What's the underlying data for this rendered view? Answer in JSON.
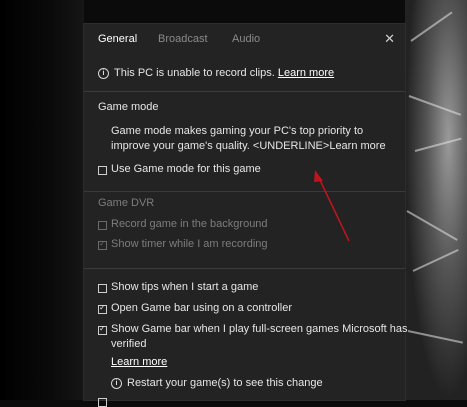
{
  "tabs": [
    {
      "label": "General",
      "active": true
    },
    {
      "label": "Broadcast",
      "active": false
    },
    {
      "label": "Audio",
      "active": false
    }
  ],
  "close_icon": "close-icon",
  "notice": {
    "text": "This PC is unable to record clips.",
    "link": "Learn more"
  },
  "game_mode": {
    "title": "Game mode",
    "description": "Game mode makes gaming your PC's top priority to improve your game's quality.",
    "description_suffix": "<UNDERLINE>Learn more",
    "checkbox_label": "Use Game mode for this game",
    "checked": false
  },
  "game_dvr": {
    "title": "Game DVR",
    "record_label": "Record game in the background",
    "record_checked": false,
    "timer_label": "Show timer while I am recording",
    "timer_checked": true
  },
  "options": {
    "tips_label": "Show tips when I start a game",
    "tips_checked": false,
    "controller_label": "Open Game bar using  on a controller",
    "controller_checked": true,
    "fullscreen_label_line1": "Show Game bar when I play full-screen games Microsoft has",
    "fullscreen_label_line2": "verified",
    "fullscreen_checked": true,
    "learn_more": "Learn more",
    "restart_note": "Restart your game(s) to see this change"
  },
  "colors": {
    "panel": "#232323",
    "annotation_arrow": "#c0141c"
  }
}
